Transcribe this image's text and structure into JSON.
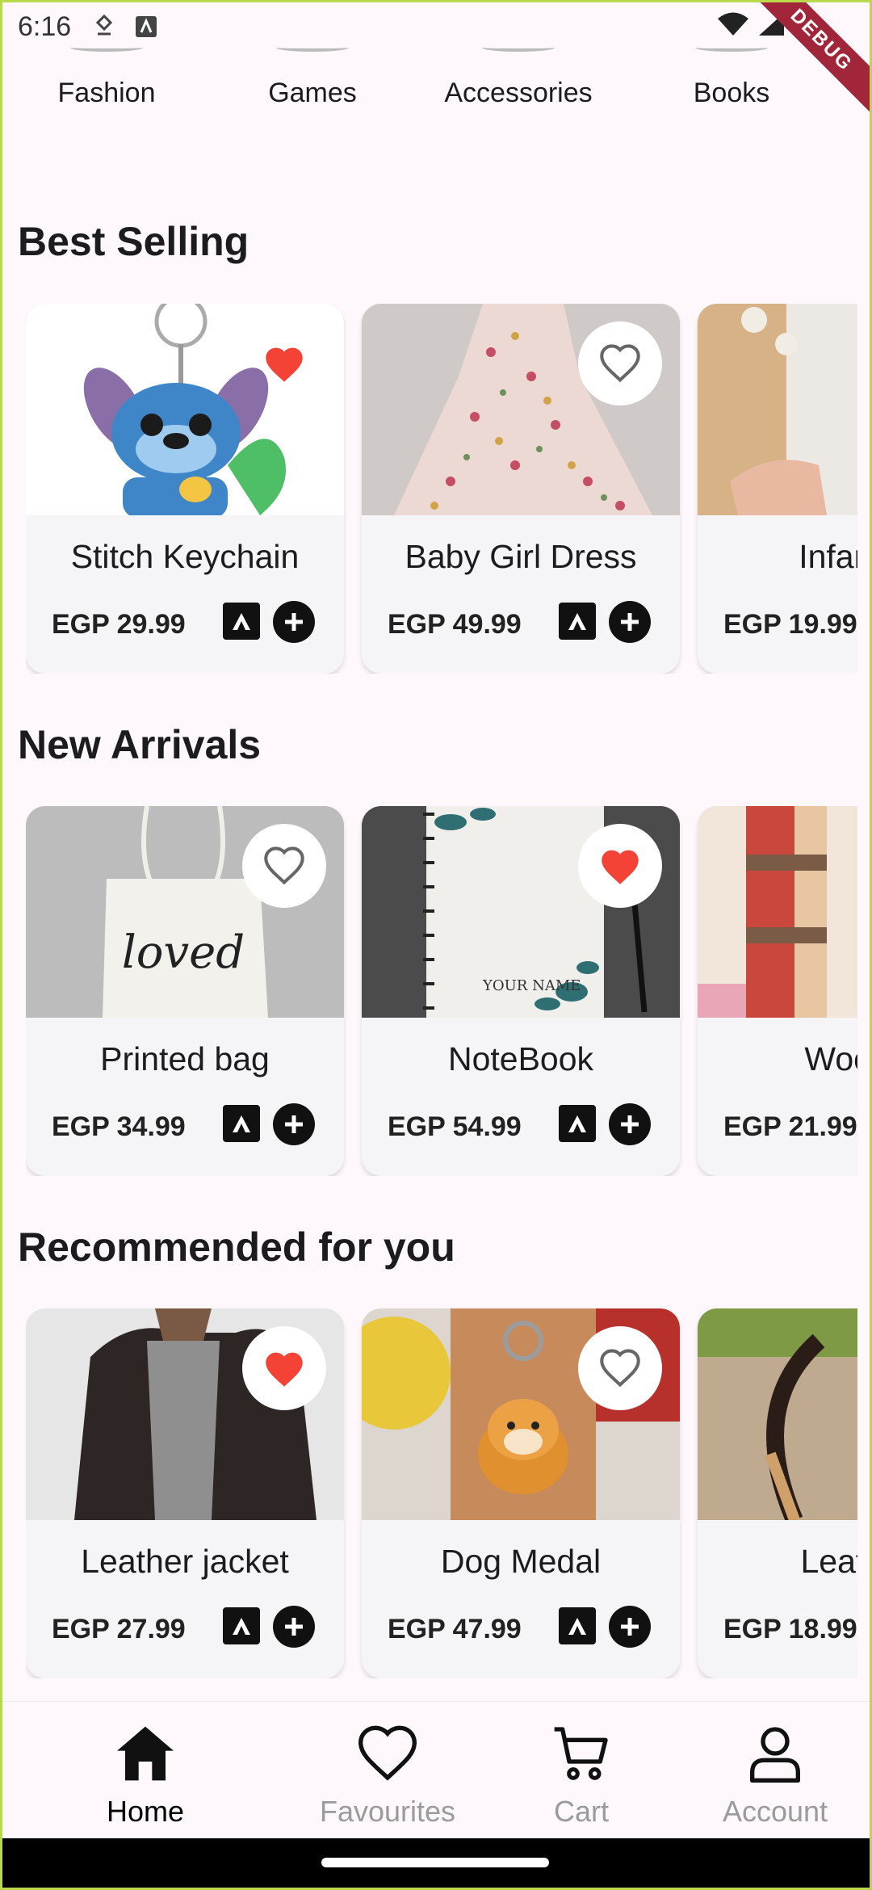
{
  "status_bar": {
    "time": "6:16",
    "debug_label": "DEBUG"
  },
  "categories": [
    {
      "label": "Fashion"
    },
    {
      "label": "Games"
    },
    {
      "label": "Accessories"
    },
    {
      "label": "Books"
    }
  ],
  "sections": {
    "best_selling": {
      "title": "Best Selling",
      "items": [
        {
          "name": "Stitch Keychain",
          "price": "EGP 29.99",
          "favourited": true
        },
        {
          "name": "Baby Girl Dress",
          "price": "EGP 49.99",
          "favourited": false
        },
        {
          "name": "Infant H",
          "price": "EGP 19.99",
          "favourited": false
        }
      ]
    },
    "new_arrivals": {
      "title": "New Arrivals",
      "items": [
        {
          "name": "Printed bag",
          "price": "EGP 34.99",
          "favourited": false,
          "image_text": "loved"
        },
        {
          "name": "NoteBook",
          "price": "EGP 54.99",
          "favourited": true,
          "image_text": "YOUR NAME"
        },
        {
          "name": "Wooler",
          "price": "EGP 21.99",
          "favourited": false
        }
      ]
    },
    "recommended": {
      "title": "Recommended for you",
      "items": [
        {
          "name": "Leather jacket",
          "price": "EGP 27.99",
          "favourited": true
        },
        {
          "name": "Dog Medal",
          "price": "EGP 47.99",
          "favourited": false
        },
        {
          "name": "Leather",
          "price": "EGP 18.99",
          "favourited": false
        }
      ]
    }
  },
  "bottom_nav": {
    "items": [
      {
        "label": "Home",
        "icon": "home-icon",
        "active": true
      },
      {
        "label": "Favourites",
        "icon": "heart-icon",
        "active": false
      },
      {
        "label": "Cart",
        "icon": "cart-icon",
        "active": false
      },
      {
        "label": "Account",
        "icon": "person-icon",
        "active": false
      }
    ]
  },
  "colors": {
    "background": "#fef7fc",
    "favourite_red": "#f44336",
    "card_bg": "#f5f4f7",
    "inactive_nav": "#9b9b9b"
  }
}
